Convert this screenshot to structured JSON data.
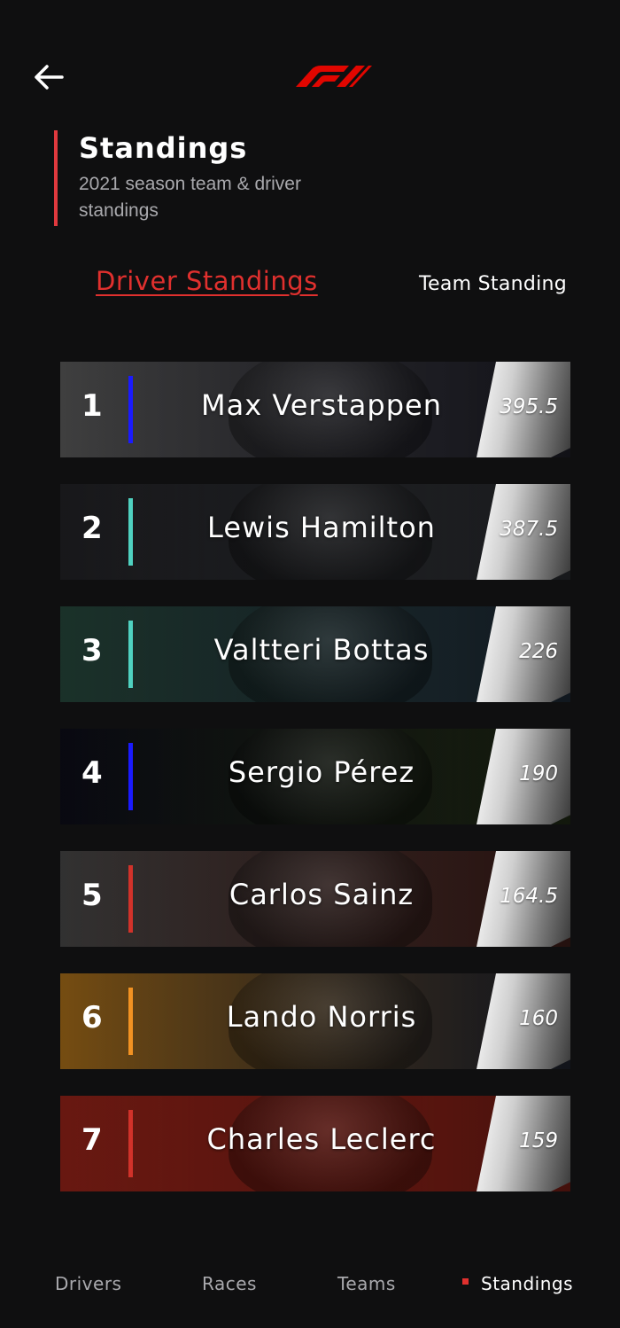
{
  "header": {
    "back_icon": "arrow-left-icon",
    "logo": "F1"
  },
  "title_block": {
    "title": "Standings",
    "subtitle": "2021 season team & driver standings"
  },
  "tabs": [
    {
      "label": "Driver Standings",
      "active": true
    },
    {
      "label": "Team Standing",
      "active": false
    }
  ],
  "standings": [
    {
      "position": "1",
      "driver": "Max Verstappen",
      "points": "395.5",
      "team_color": "#1a1aff",
      "photo_tone": [
        "#4a4a4a",
        "#2a2a38"
      ]
    },
    {
      "position": "2",
      "driver": "Lewis Hamilton",
      "points": "387.5",
      "team_color": "#4fd1c0",
      "photo_tone": [
        "#1c1c1f",
        "#3b3e44"
      ]
    },
    {
      "position": "3",
      "driver": "Valtteri Bottas",
      "points": "226",
      "team_color": "#4fd1c0",
      "photo_tone": [
        "#1f3a30",
        "#2a3b4c"
      ]
    },
    {
      "position": "4",
      "driver": "Sergio Pérez",
      "points": "190",
      "team_color": "#1a1aff",
      "photo_tone": [
        "#0a0a14",
        "#2c3a1e"
      ]
    },
    {
      "position": "5",
      "driver": "Carlos Sainz",
      "points": "164.5",
      "team_color": "#d1322a",
      "photo_tone": [
        "#3a3a3a",
        "#5a2a24"
      ]
    },
    {
      "position": "6",
      "driver": "Lando Norris",
      "points": "160",
      "team_color": "#f29222",
      "photo_tone": [
        "#8a5a14",
        "#2b3142"
      ]
    },
    {
      "position": "7",
      "driver": "Charles Leclerc",
      "points": "159",
      "team_color": "#d1322a",
      "photo_tone": [
        "#7a1c14",
        "#a8281c"
      ]
    }
  ],
  "bottom_nav": [
    {
      "label": "Drivers",
      "active": false
    },
    {
      "label": "Races",
      "active": false
    },
    {
      "label": "Teams",
      "active": false
    },
    {
      "label": "Standings",
      "active": true
    }
  ],
  "colors": {
    "accent": "#e0302e",
    "background": "#0f0f10",
    "muted_text": "#a9a9ad"
  }
}
